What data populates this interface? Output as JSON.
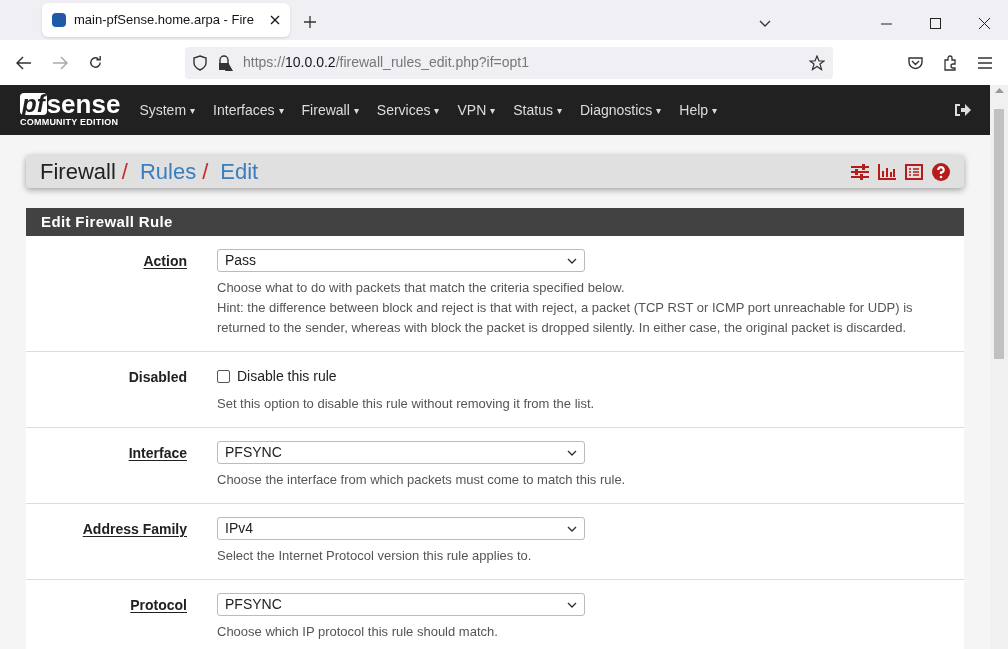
{
  "browser": {
    "tab_title": "main-pfSense.home.arpa - Fire",
    "url_scheme": "https://",
    "url_host": "10.0.0.2",
    "url_path": "/firewall_rules_edit.php?if=opt1"
  },
  "logo": {
    "mark": "pf",
    "word": "sense",
    "edition": "COMMUNITY EDITION"
  },
  "menu": [
    {
      "label": "System",
      "caret": "▾"
    },
    {
      "label": "Interfaces",
      "caret": "▾"
    },
    {
      "label": "Firewall",
      "caret": "▾"
    },
    {
      "label": "Services",
      "caret": "▾"
    },
    {
      "label": "VPN",
      "caret": "▾"
    },
    {
      "label": "Status",
      "caret": "▾"
    },
    {
      "label": "Diagnostics",
      "caret": "▾"
    },
    {
      "label": "Help",
      "caret": "▾"
    }
  ],
  "breadcrumb": [
    {
      "label": "Firewall",
      "link": false,
      "separator": "/"
    },
    {
      "label": "Rules",
      "link": true,
      "separator": "/"
    },
    {
      "label": "Edit",
      "link": true
    }
  ],
  "panel": {
    "title": "Edit Firewall Rule",
    "rows": [
      {
        "label": "Action",
        "help_link": true,
        "kind": "select",
        "value": "Pass",
        "hints": [
          "Choose what to do with packets that match the criteria specified below.",
          "Hint: the difference between block and reject is that with reject, a packet (TCP RST or ICMP port unreachable for UDP) is returned to the sender, whereas with block the packet is dropped silently. In either case, the original packet is discarded."
        ]
      },
      {
        "label": "Disabled",
        "help_link": false,
        "kind": "checkbox",
        "value": "Disable this rule",
        "checked": false,
        "hints": [
          "Set this option to disable this rule without removing it from the list."
        ]
      },
      {
        "label": "Interface",
        "help_link": true,
        "kind": "select",
        "value": "PFSYNC",
        "hints": [
          "Choose the interface from which packets must come to match this rule."
        ]
      },
      {
        "label": "Address Family",
        "help_link": true,
        "kind": "select",
        "value": "IPv4",
        "hints": [
          "Select the Internet Protocol version this rule applies to."
        ]
      },
      {
        "label": "Protocol",
        "help_link": true,
        "kind": "select",
        "value": "PFSYNC",
        "hints": [
          "Choose which IP protocol this rule should match."
        ]
      }
    ]
  }
}
